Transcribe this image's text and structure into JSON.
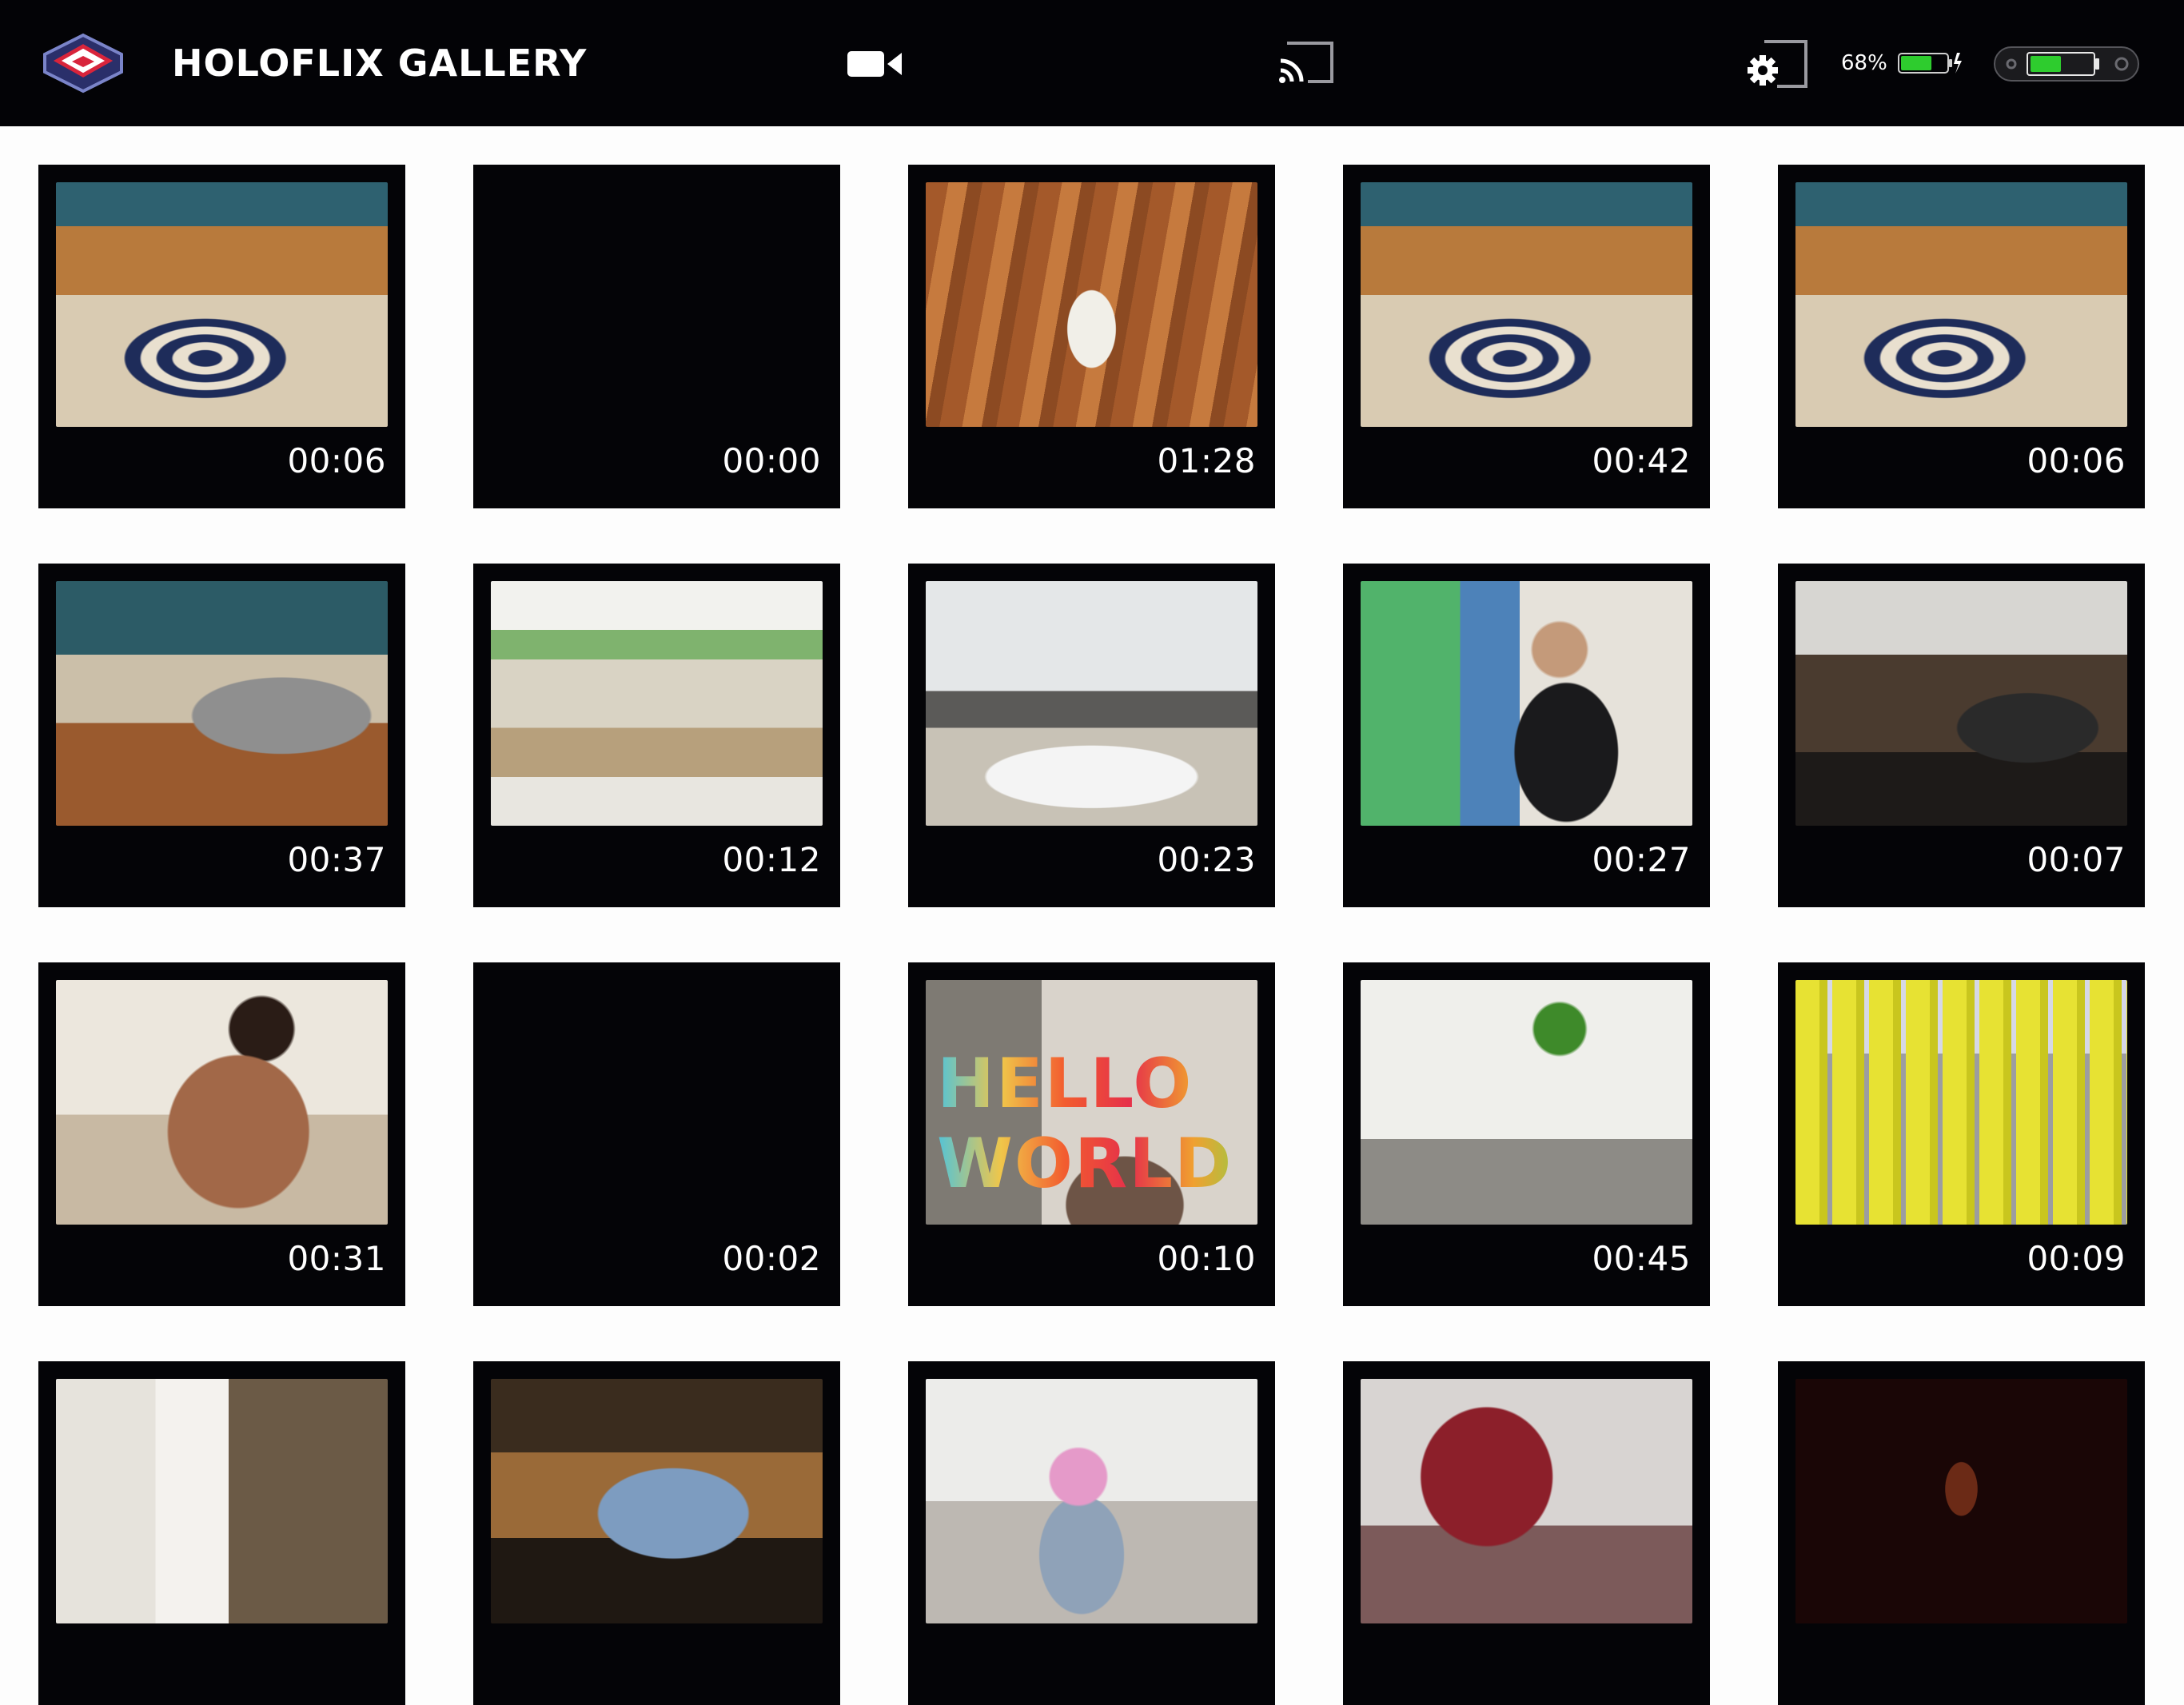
{
  "app": {
    "title": "HOLOFLIX GALLERY"
  },
  "toolbar": {
    "camera_icon": "video-camera-icon",
    "cast_icon": "cast-icon",
    "settings_icon": "gear-icon",
    "battery_percent": "68%",
    "battery_level": 0.68,
    "device_battery_level": 0.5,
    "battery_color": "#2ecc2e"
  },
  "gallery": {
    "items": [
      {
        "duration": "00:06",
        "scene": "livingroom"
      },
      {
        "duration": "00:00",
        "scene": "empty"
      },
      {
        "duration": "01:28",
        "scene": "woodfloor"
      },
      {
        "duration": "00:42",
        "scene": "livingroom"
      },
      {
        "duration": "00:06",
        "scene": "livingroom"
      },
      {
        "duration": "00:37",
        "scene": "sofa"
      },
      {
        "duration": "00:12",
        "scene": "lab"
      },
      {
        "duration": "00:23",
        "scene": "office"
      },
      {
        "duration": "00:27",
        "scene": "person-desk"
      },
      {
        "duration": "00:07",
        "scene": "dark-office"
      },
      {
        "duration": "00:31",
        "scene": "mother"
      },
      {
        "duration": "00:02",
        "scene": "empty"
      },
      {
        "duration": "00:10",
        "scene": "hello",
        "overlay_text": "HELLO WORLD"
      },
      {
        "duration": "00:45",
        "scene": "warehouse"
      },
      {
        "duration": "00:09",
        "scene": "chairs"
      },
      {
        "duration": "",
        "scene": "doorway"
      },
      {
        "duration": "",
        "scene": "laptop"
      },
      {
        "duration": "",
        "scene": "baby"
      },
      {
        "duration": "",
        "scene": "kitchen"
      },
      {
        "duration": "",
        "scene": "night"
      }
    ]
  }
}
